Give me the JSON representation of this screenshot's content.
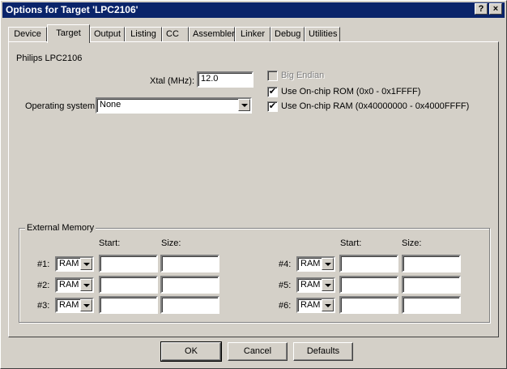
{
  "window": {
    "title": "Options for Target 'LPC2106'",
    "help_btn": "?",
    "close_btn": "×"
  },
  "tabs": [
    {
      "label": "Device"
    },
    {
      "label": "Target"
    },
    {
      "label": "Output"
    },
    {
      "label": "Listing"
    },
    {
      "label": "CC"
    },
    {
      "label": "Assembler"
    },
    {
      "label": "Linker"
    },
    {
      "label": "Debug"
    },
    {
      "label": "Utilities"
    }
  ],
  "target": {
    "device_name": "Philips LPC2106",
    "xtal_label": "Xtal (MHz):",
    "xtal_value": "12.0",
    "os_label": "Operating system:",
    "os_value": "None",
    "big_endian": {
      "label": "Big Endian",
      "checked": false,
      "enabled": false
    },
    "onchip_rom": {
      "label": "Use On-chip ROM (0x0 - 0x1FFFF)",
      "checked": true,
      "mark": "✔"
    },
    "onchip_ram": {
      "label": "Use On-chip RAM (0x40000000 - 0x4000FFFF)",
      "checked": true,
      "mark": "✔"
    }
  },
  "external_memory": {
    "title": "External Memory",
    "start_label": "Start:",
    "size_label": "Size:",
    "rows": [
      {
        "num": "#1:",
        "type": "RAM",
        "start": "",
        "size": ""
      },
      {
        "num": "#2:",
        "type": "RAM",
        "start": "",
        "size": ""
      },
      {
        "num": "#3:",
        "type": "RAM",
        "start": "",
        "size": ""
      },
      {
        "num": "#4:",
        "type": "RAM",
        "start": "",
        "size": ""
      },
      {
        "num": "#5:",
        "type": "RAM",
        "start": "",
        "size": ""
      },
      {
        "num": "#6:",
        "type": "RAM",
        "start": "",
        "size": ""
      }
    ]
  },
  "buttons": {
    "ok": "OK",
    "cancel": "Cancel",
    "defaults": "Defaults"
  },
  "colors": {
    "titlebar": "#0a246a",
    "face": "#d4d0c8"
  }
}
